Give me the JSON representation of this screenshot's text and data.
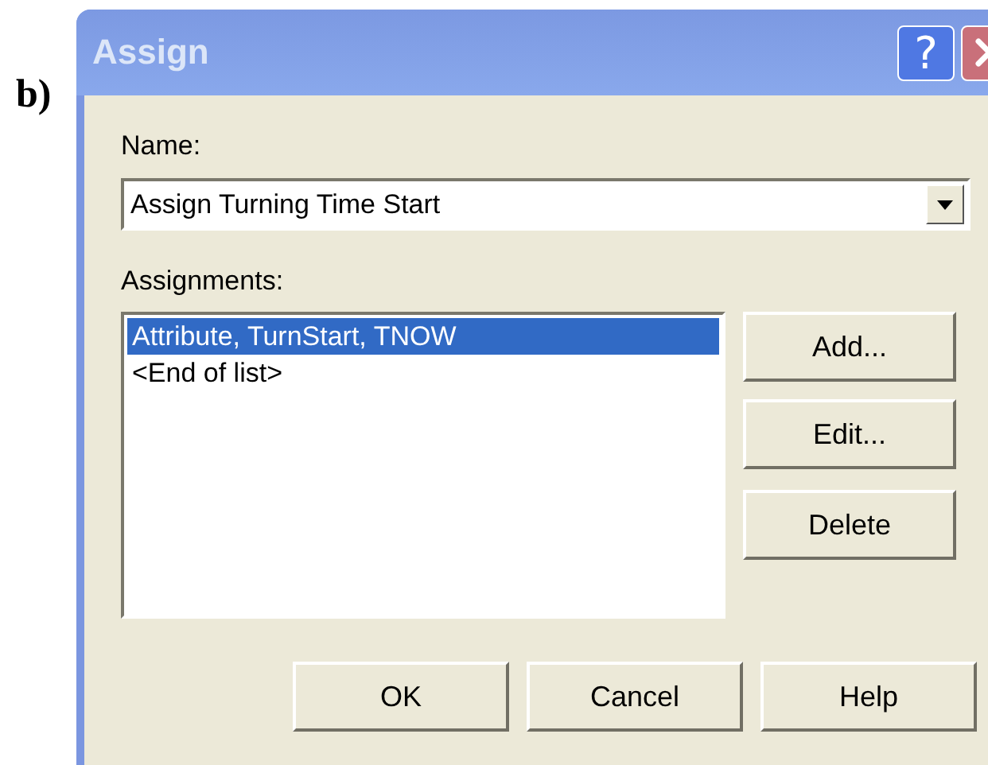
{
  "label": "b)",
  "window": {
    "title": "Assign",
    "help_button": "?"
  },
  "name": {
    "label": "Name:",
    "value": "Assign Turning Time Start"
  },
  "assignments": {
    "label": "Assignments:",
    "items": [
      {
        "text": "Attribute, TurnStart, TNOW",
        "selected": true
      },
      {
        "text": "<End of list>",
        "selected": false
      }
    ]
  },
  "side_buttons": [
    "Add...",
    "Edit...",
    "Delete"
  ],
  "buttons": [
    "OK",
    "Cancel",
    "Help"
  ]
}
